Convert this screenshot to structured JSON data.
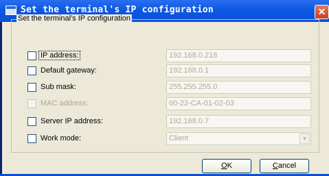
{
  "window": {
    "title": "Set the terminal's IP configuration",
    "close_label": "✕"
  },
  "group": {
    "legend": "Set the terminal's IP configuration"
  },
  "rows": [
    {
      "label": "IP address:",
      "value": "192.168.0.218",
      "checked": false,
      "enabled": true,
      "focused": true
    },
    {
      "label": "Default gateway:",
      "value": "192.168.0.1",
      "checked": false,
      "enabled": true
    },
    {
      "label": "Sub mask:",
      "value": "255.255.255.0",
      "checked": false,
      "enabled": true
    },
    {
      "label": "MAC address:",
      "value": "00-22-CA-01-02-03",
      "checked": false,
      "enabled": false
    },
    {
      "label": "Server IP address:",
      "value": "192.168.0.7",
      "checked": false,
      "enabled": true
    },
    {
      "label": "Work mode:",
      "value": "Client",
      "checked": false,
      "enabled": true,
      "type": "select"
    }
  ],
  "buttons": {
    "ok_mnemonic": "O",
    "ok_rest": "K",
    "cancel_mnemonic": "C",
    "cancel_rest": "ancel"
  }
}
